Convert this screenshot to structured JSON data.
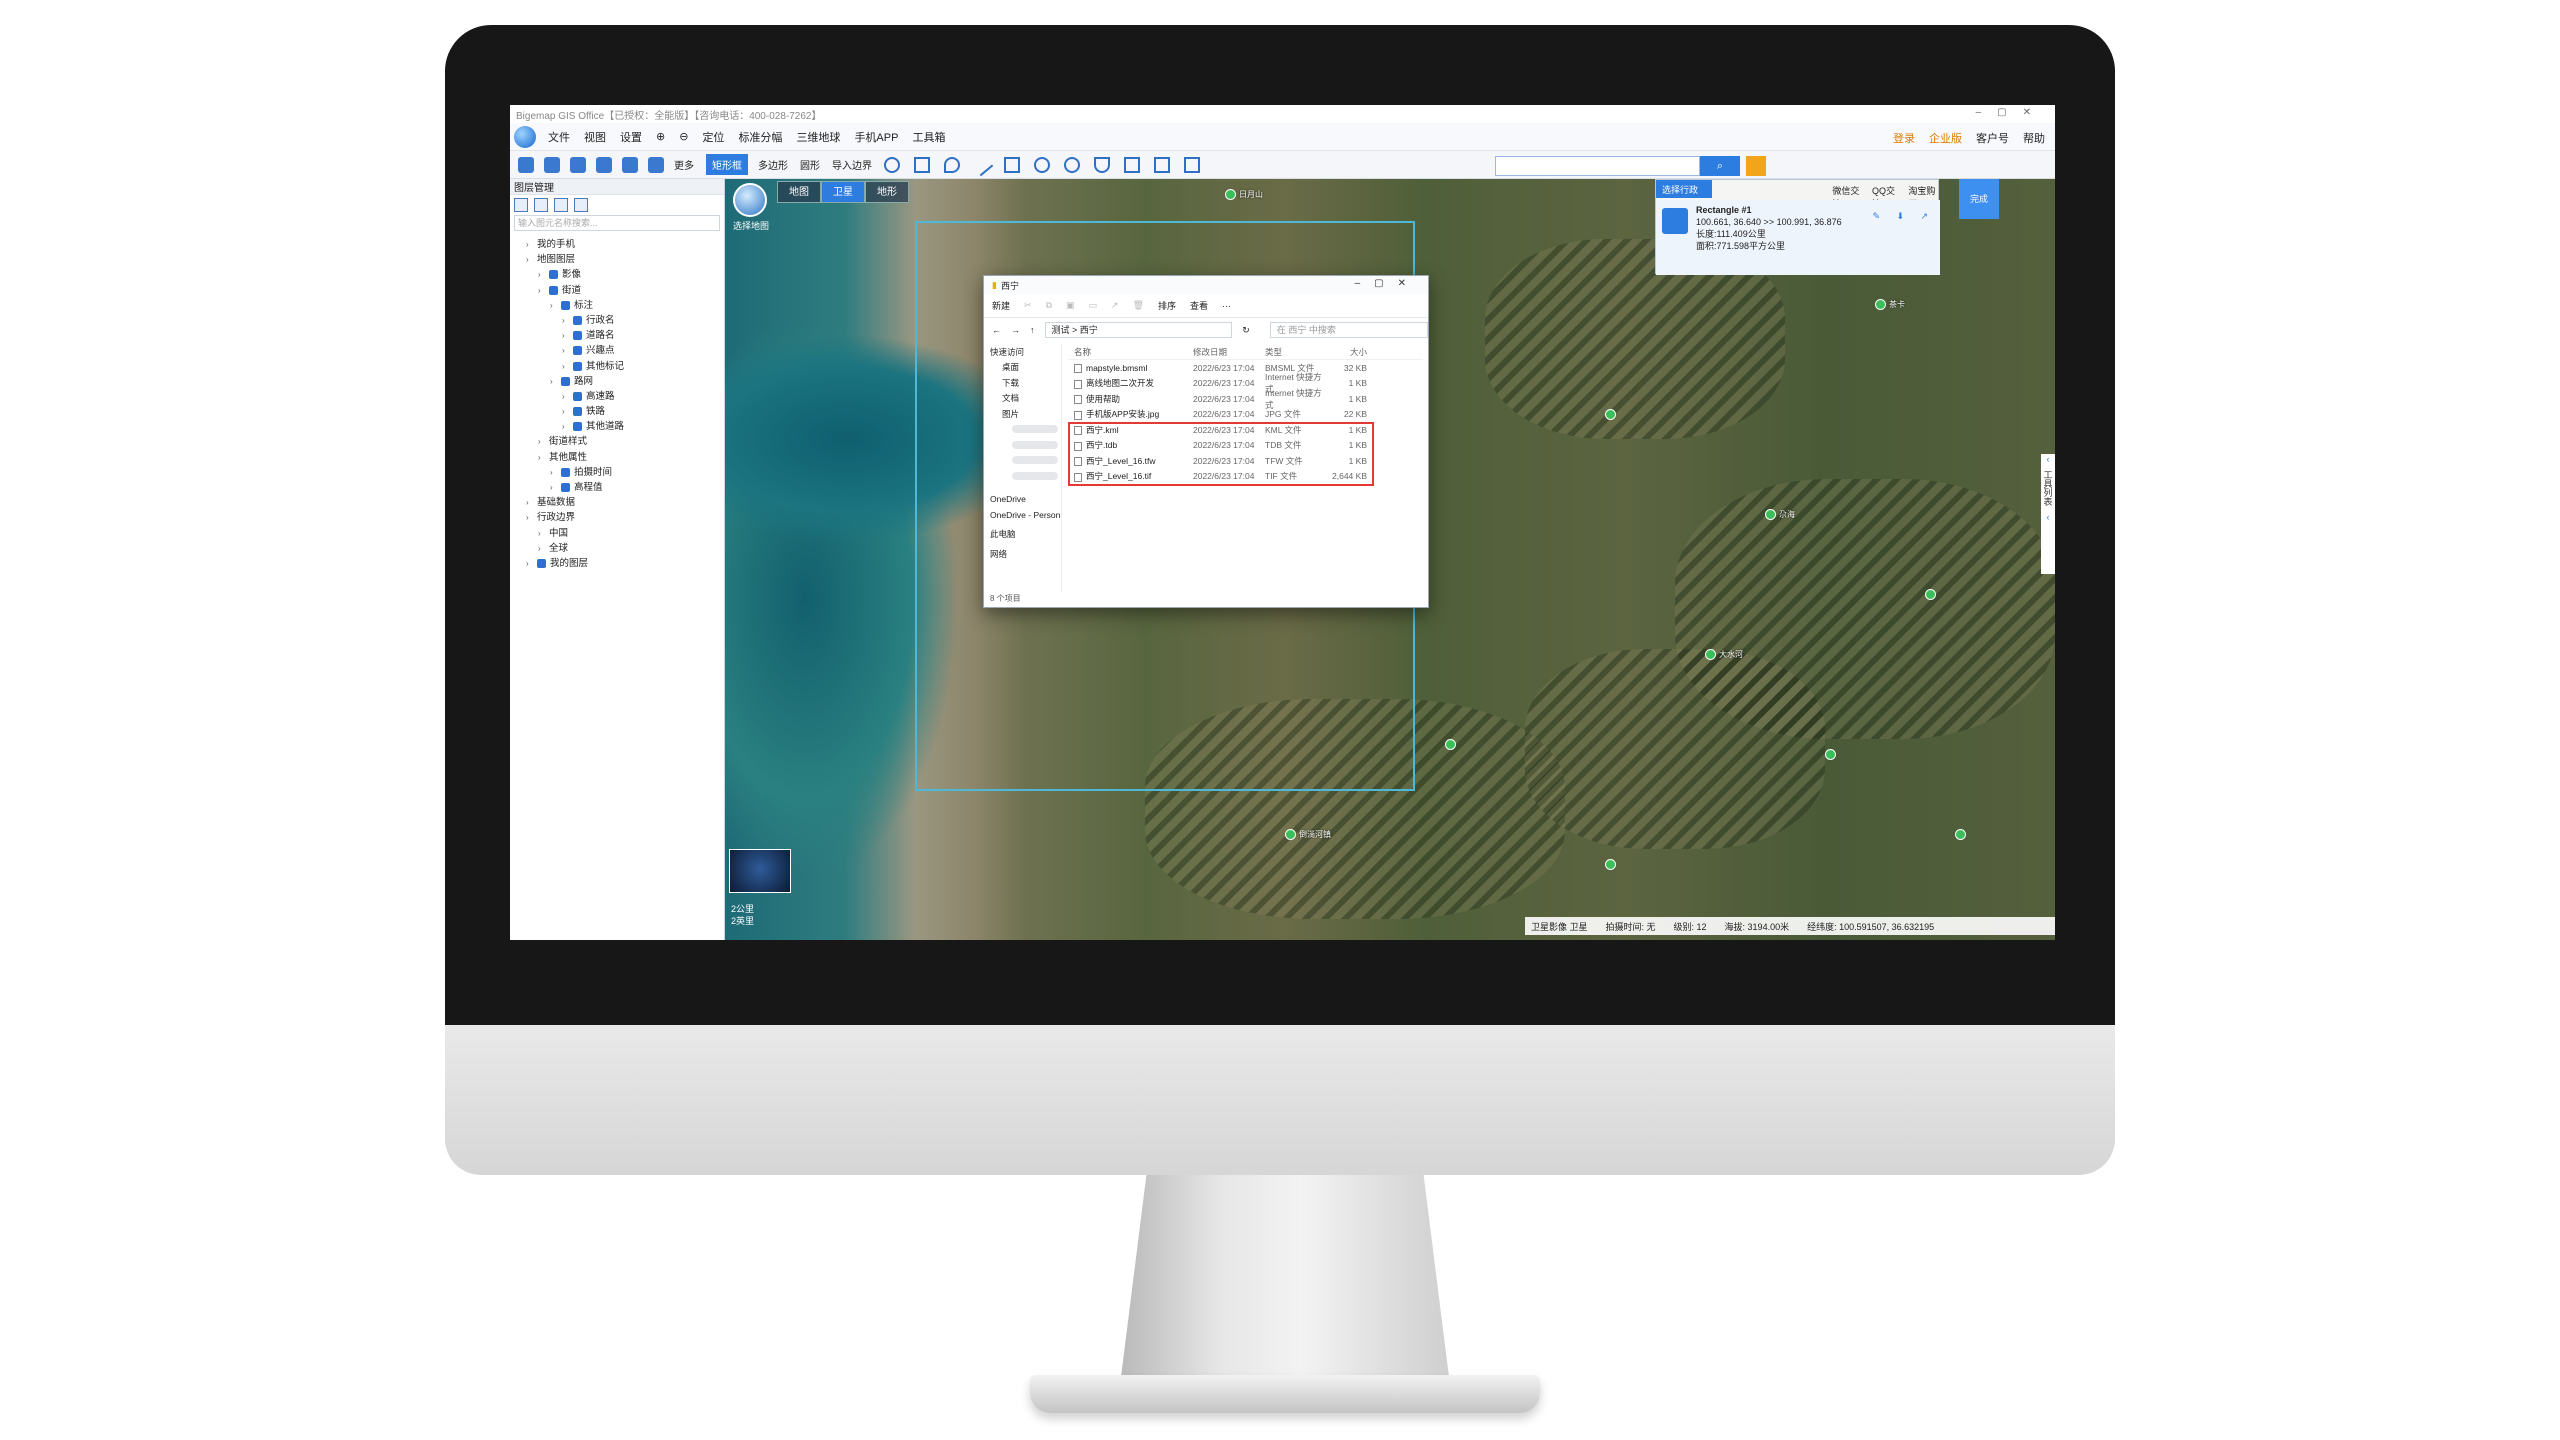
{
  "app": {
    "title": "Bigemap GIS Office【已授权：全能版】【咨询电话：400-028-7262】",
    "menu": [
      "文件",
      "视图",
      "设置",
      "定位",
      "标准分幅",
      "三维地球",
      "手机APP",
      "工具箱"
    ],
    "menu_right": [
      "登录",
      "企业版",
      "客户号",
      "帮助"
    ]
  },
  "toolbar": {
    "more_label": "更多",
    "rect_label": "矩形框",
    "poly_label": "多边形",
    "circle_label": "圆形",
    "import_label": "导入边界"
  },
  "layer_panel": {
    "title": "图层管理",
    "search_placeholder": "输入图元名称搜索...",
    "tree": [
      {
        "label": "我的手机",
        "level": 1,
        "checked": false
      },
      {
        "label": "地图图层",
        "level": 1,
        "checked": false
      },
      {
        "label": "影像",
        "level": 2,
        "checked": true
      },
      {
        "label": "街道",
        "level": 2,
        "checked": true
      },
      {
        "label": "标注",
        "level": 3,
        "checked": true
      },
      {
        "label": "行政名",
        "level": 4,
        "checked": true
      },
      {
        "label": "道路名",
        "level": 4,
        "checked": true
      },
      {
        "label": "兴趣点",
        "level": 4,
        "checked": true
      },
      {
        "label": "其他标记",
        "level": 4,
        "checked": true
      },
      {
        "label": "路网",
        "level": 3,
        "checked": true
      },
      {
        "label": "高速路",
        "level": 4,
        "checked": true
      },
      {
        "label": "铁路",
        "level": 4,
        "checked": true
      },
      {
        "label": "其他道路",
        "level": 4,
        "checked": true
      },
      {
        "label": "街道样式",
        "level": 2,
        "checked": false
      },
      {
        "label": "其他属性",
        "level": 2,
        "checked": false
      },
      {
        "label": "拍摄时间",
        "level": 3,
        "checked": true
      },
      {
        "label": "高程值",
        "level": 3,
        "checked": true
      },
      {
        "label": "基础数据",
        "level": 1,
        "checked": false
      },
      {
        "label": "行政边界",
        "level": 1,
        "checked": false
      },
      {
        "label": "中国",
        "level": 2,
        "checked": false
      },
      {
        "label": "全球",
        "level": 2,
        "checked": false
      },
      {
        "label": "我的图层",
        "level": 1,
        "checked": true
      }
    ]
  },
  "map": {
    "tabs": [
      "地图",
      "卫星",
      "地形"
    ],
    "active_tab": "卫星",
    "choose_map_label": "选择地图",
    "admin_tab": "选择行政区域",
    "social_tabs": [
      "微信交流",
      "QQ交流",
      "淘宝购买"
    ],
    "close_label": "完成",
    "rect_name": "Rectangle #1",
    "rect_coords": "100.661, 36.640 >> 100.991, 36.876",
    "rect_length": "长度:111.409公里",
    "rect_area": "面积:771.598平方公里",
    "side_panel": "工具列表",
    "scale_1": "2公里",
    "scale_2": "2英里",
    "status": {
      "layer": "卫星影像 卫星",
      "shot_time": "拍摄时间: 无",
      "level": "级别: 12",
      "elevation": "海拔: 3194.00米",
      "lonlat": "经纬度: 100.591507, 36.632195"
    }
  },
  "explorer": {
    "title": "西宁",
    "cmd": [
      "新建",
      "排序",
      "查看"
    ],
    "breadcrumb": "测试 > 西宁",
    "search_placeholder": "在 西宁 中搜索",
    "nav": [
      "快速访问",
      "桌面",
      "下载",
      "文档",
      "图片",
      "OneDrive",
      "OneDrive - Person",
      "此电脑",
      "网络"
    ],
    "columns": [
      "名称",
      "修改日期",
      "类型",
      "大小"
    ],
    "files": [
      {
        "name": "mapstyle.bmsml",
        "date": "2022/6/23 17:04",
        "type": "BMSML 文件",
        "size": "32 KB"
      },
      {
        "name": "离线地图二次开发",
        "date": "2022/6/23 17:04",
        "type": "Internet 快捷方式",
        "size": "1 KB"
      },
      {
        "name": "使用帮助",
        "date": "2022/6/23 17:04",
        "type": "Internet 快捷方式",
        "size": "1 KB"
      },
      {
        "name": "手机版APP安装.jpg",
        "date": "2022/6/23 17:04",
        "type": "JPG 文件",
        "size": "22 KB"
      },
      {
        "name": "西宁.kml",
        "date": "2022/6/23 17:04",
        "type": "KML 文件",
        "size": "1 KB"
      },
      {
        "name": "西宁.tdb",
        "date": "2022/6/23 17:04",
        "type": "TDB 文件",
        "size": "1 KB"
      },
      {
        "name": "西宁_Level_16.tfw",
        "date": "2022/6/23 17:04",
        "type": "TFW 文件",
        "size": "1 KB"
      },
      {
        "name": "西宁_Level_16.tif",
        "date": "2022/6/23 17:04",
        "type": "TIF 文件",
        "size": "2,644 KB"
      }
    ],
    "item_count": "8 个项目"
  },
  "poi_labels": [
    "日月山",
    "茶卡",
    "尕海",
    "大水河",
    "倒淌河镇"
  ]
}
